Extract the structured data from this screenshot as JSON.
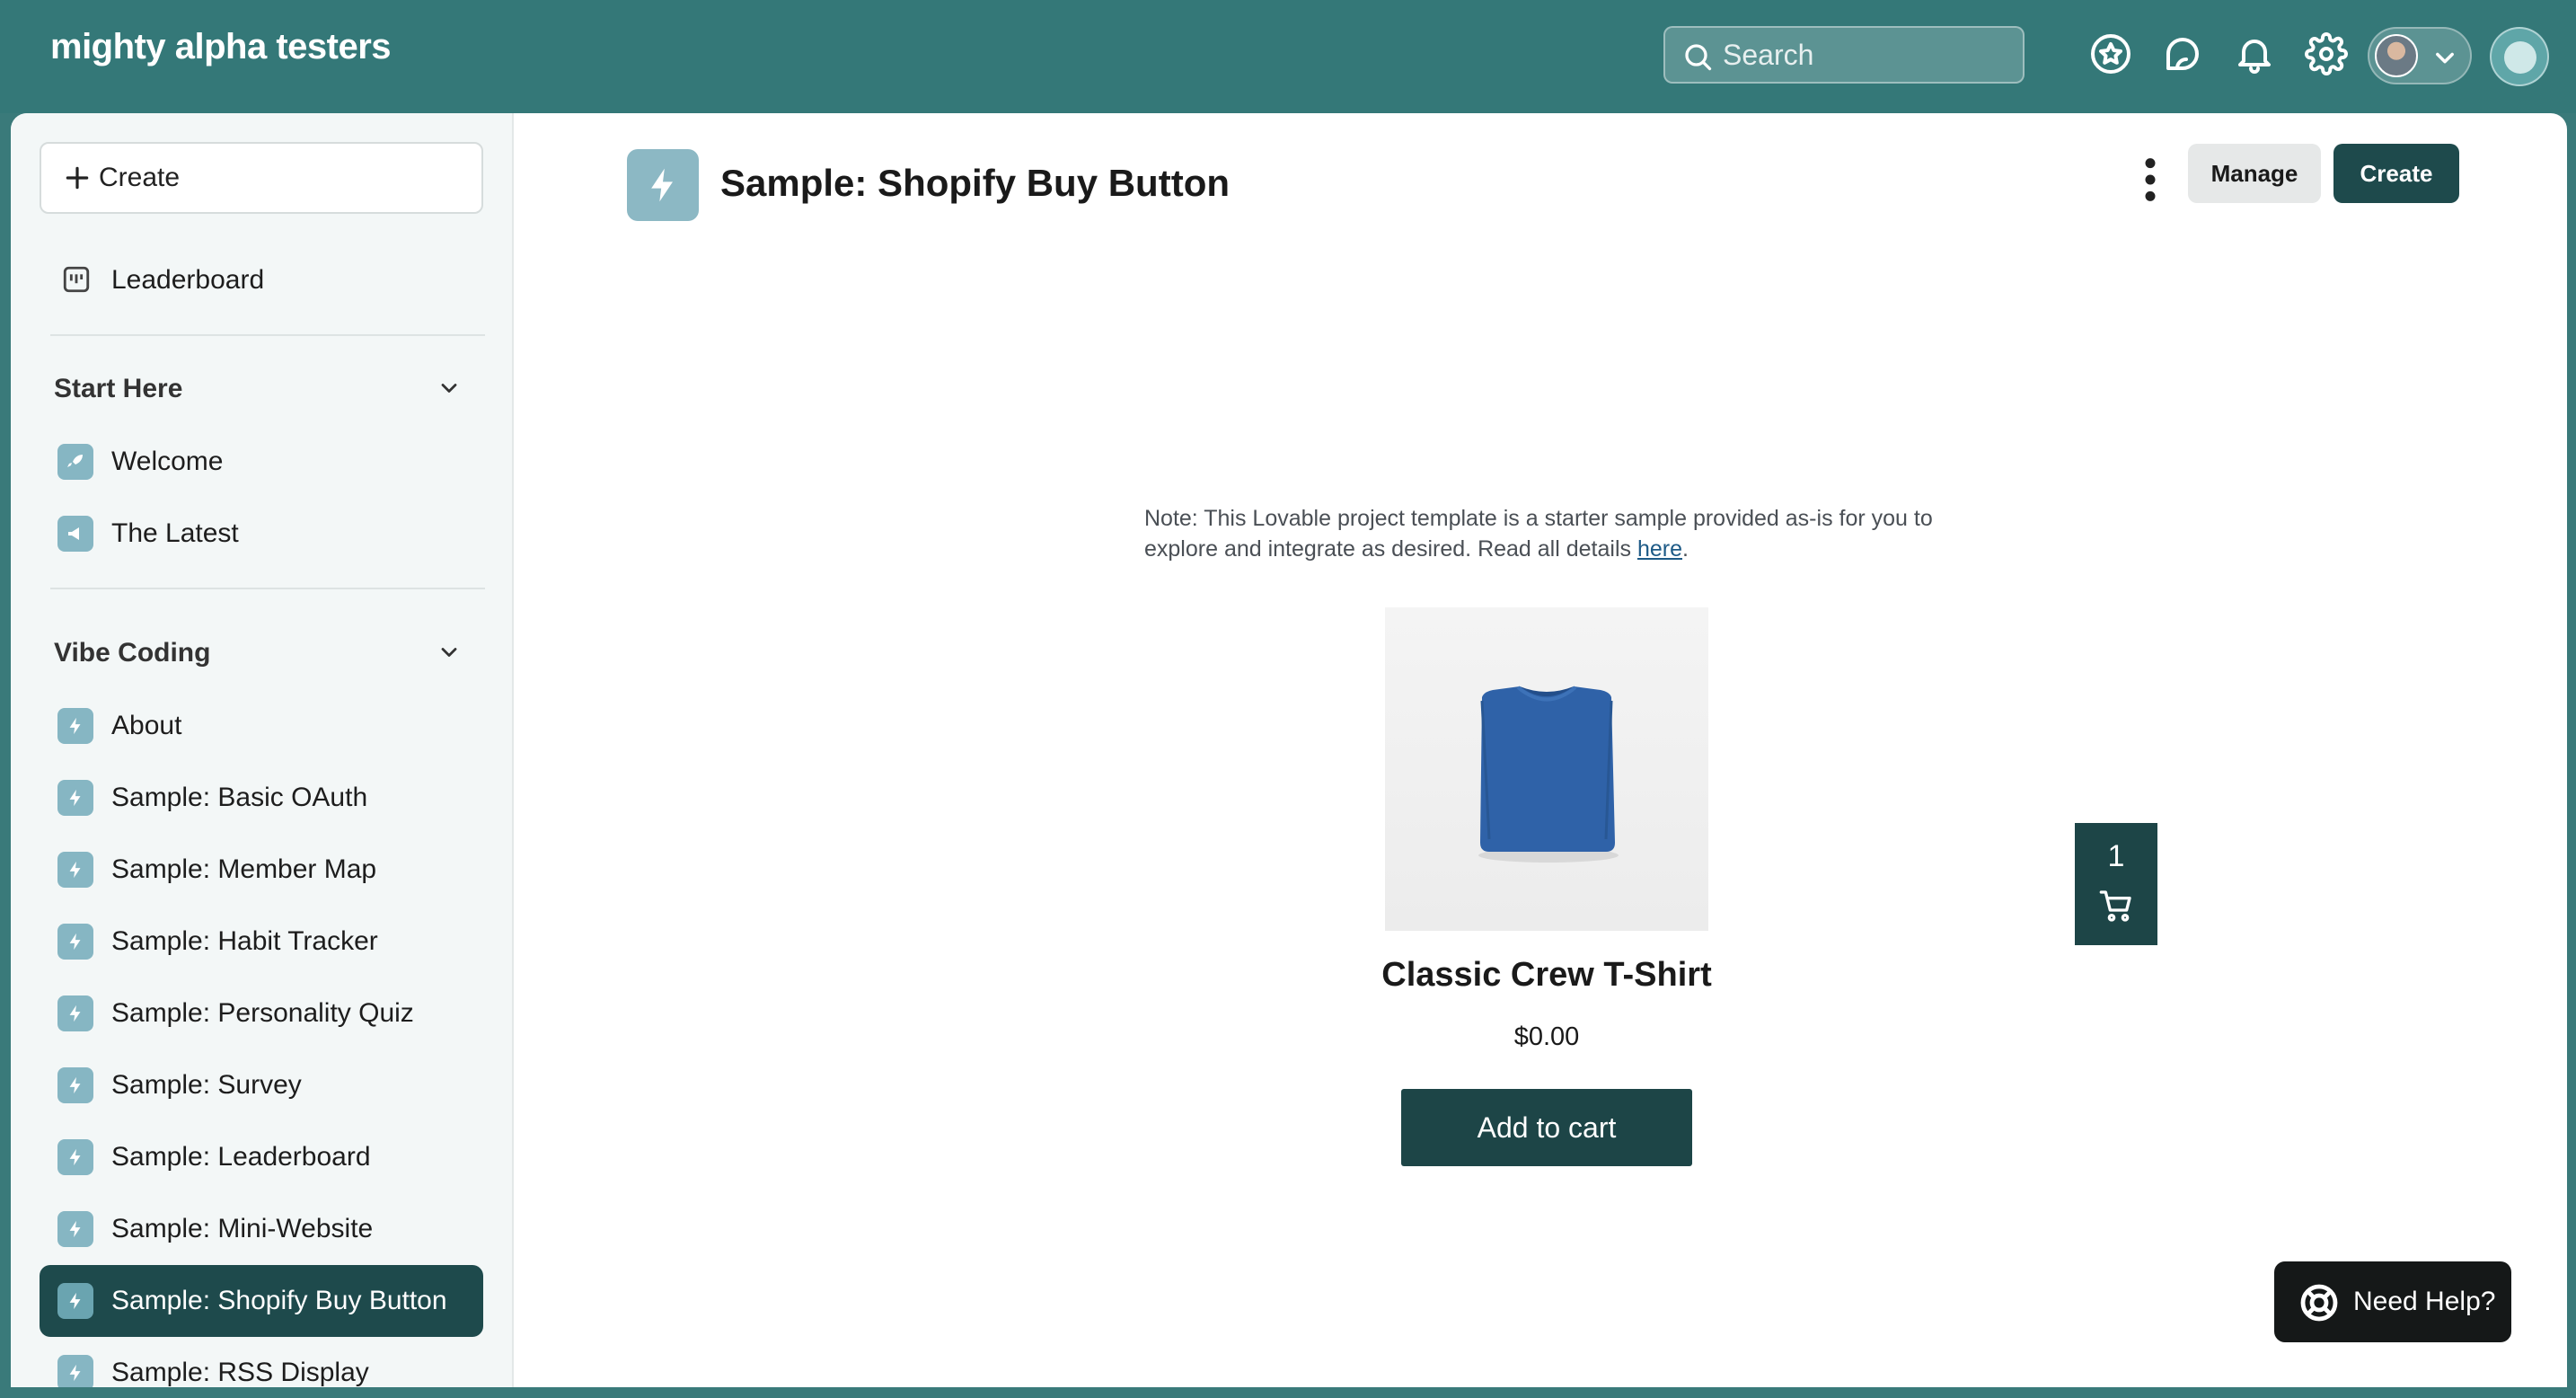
{
  "app": {
    "brand": "mighty alpha testers"
  },
  "topbar": {
    "search_placeholder": "Search",
    "icons": [
      "star-badge-icon",
      "chat-icon",
      "bell-icon",
      "gear-icon",
      "avatar",
      "chevron-down-icon",
      "org-logo"
    ]
  },
  "sidebar": {
    "create_label": "Create",
    "leaderboard_label": "Leaderboard",
    "sections": [
      {
        "title": "Start Here",
        "items": [
          {
            "label": "Welcome",
            "icon": "rocket-icon"
          },
          {
            "label": "The Latest",
            "icon": "megaphone-icon"
          }
        ]
      },
      {
        "title": "Vibe Coding",
        "items": [
          {
            "label": "About",
            "icon": "bolt-icon"
          },
          {
            "label": "Sample: Basic OAuth",
            "icon": "bolt-icon"
          },
          {
            "label": "Sample: Member Map",
            "icon": "bolt-icon"
          },
          {
            "label": "Sample: Habit Tracker",
            "icon": "bolt-icon"
          },
          {
            "label": "Sample: Personality Quiz",
            "icon": "bolt-icon"
          },
          {
            "label": "Sample: Survey",
            "icon": "bolt-icon"
          },
          {
            "label": "Sample: Leaderboard",
            "icon": "bolt-icon"
          },
          {
            "label": "Sample: Mini-Website",
            "icon": "bolt-icon"
          },
          {
            "label": "Sample: Shopify Buy Button",
            "icon": "bolt-icon",
            "active": true
          },
          {
            "label": "Sample: RSS Display",
            "icon": "bolt-icon"
          }
        ]
      }
    ]
  },
  "page": {
    "title": "Sample: Shopify Buy Button",
    "manage_label": "Manage",
    "create_label": "Create",
    "note_text": "Note: This Lovable project template is a starter sample provided as-is for you to explore and integrate as desired. Read all details ",
    "note_link": "here",
    "note_end": ".",
    "product": {
      "name": "Classic Crew T-Shirt",
      "price": "$0.00",
      "cta": "Add to cart"
    },
    "cart_count": "1",
    "help_label": "Need Help?"
  },
  "colors": {
    "topbar": "#347878",
    "accent_dark": "#1e4a4c",
    "icon_tile": "#86b6c3",
    "shirt": "#2f62a8"
  }
}
